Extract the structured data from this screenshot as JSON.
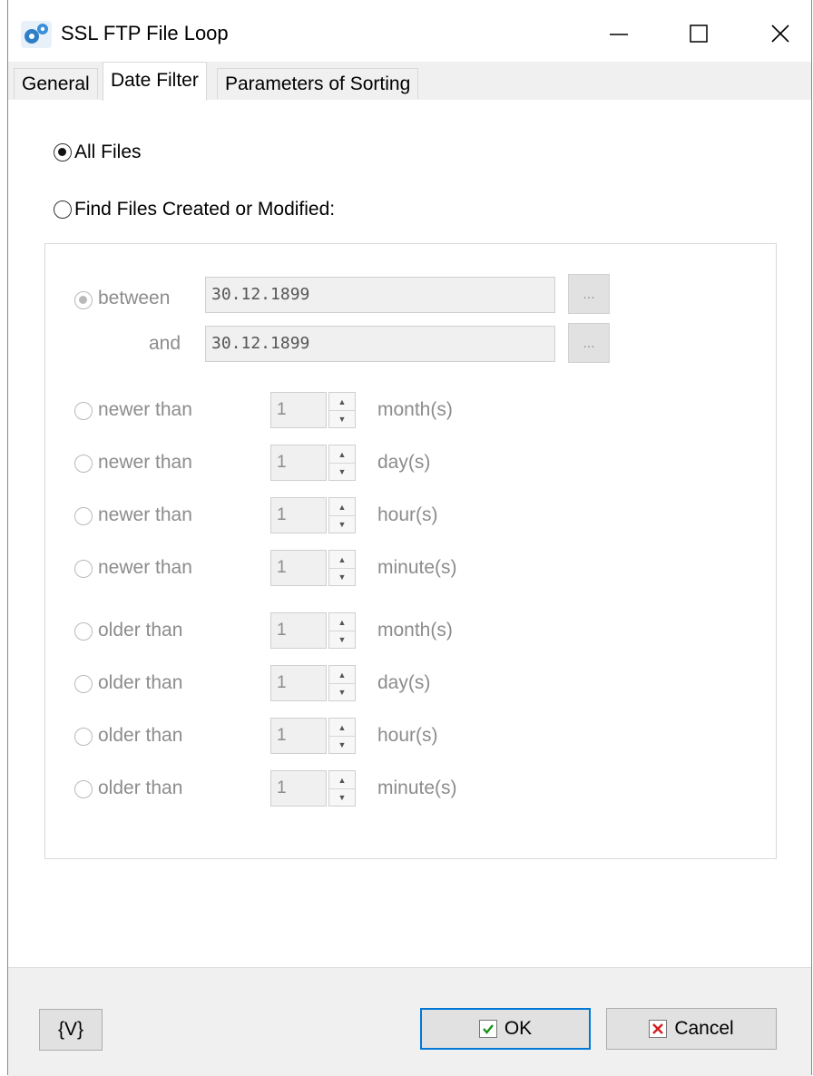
{
  "window": {
    "title": "SSL FTP File Loop"
  },
  "tabs": [
    {
      "label": "General"
    },
    {
      "label": "Date Filter"
    },
    {
      "label": "Parameters of Sorting"
    }
  ],
  "options": {
    "all_files": "All Files",
    "find_files": "Find Files Created or Modified:"
  },
  "range": {
    "between_label": "between",
    "and_label": "and",
    "from_value": "30.12.1899",
    "to_value": "30.12.1899",
    "browse_label": "..."
  },
  "rows": [
    {
      "label": "newer than",
      "value": "1",
      "unit": "month(s)"
    },
    {
      "label": "newer than",
      "value": "1",
      "unit": "day(s)"
    },
    {
      "label": "newer than",
      "value": "1",
      "unit": "hour(s)"
    },
    {
      "label": "newer than",
      "value": "1",
      "unit": "minute(s)"
    },
    {
      "label": "older than",
      "value": "1",
      "unit": "month(s)"
    },
    {
      "label": "older than",
      "value": "1",
      "unit": "day(s)"
    },
    {
      "label": "older than",
      "value": "1",
      "unit": "hour(s)"
    },
    {
      "label": "older than",
      "value": "1",
      "unit": "minute(s)"
    }
  ],
  "footer": {
    "variables_label": "{V}",
    "ok_label": "OK",
    "cancel_label": "Cancel"
  },
  "colors": {
    "accent": "#0078d7",
    "ok_check": "#1a8f1a",
    "cancel_x": "#d21f1f"
  }
}
